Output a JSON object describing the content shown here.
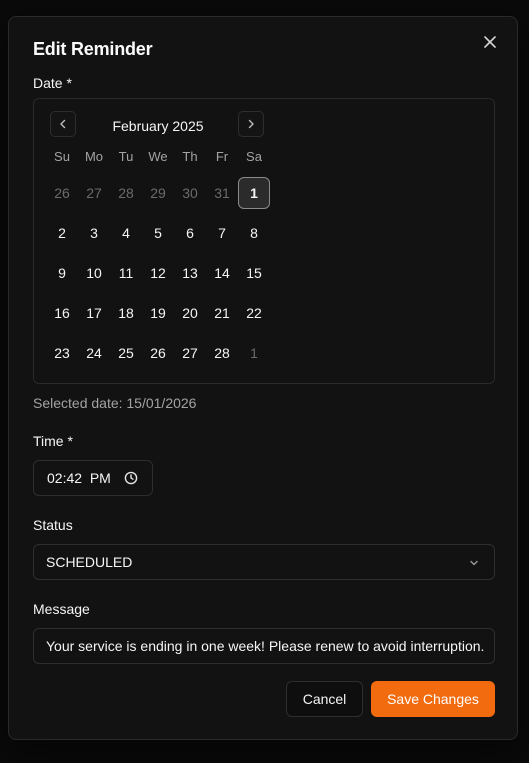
{
  "dialog": {
    "title": "Edit Reminder"
  },
  "date_field": {
    "label": "Date *",
    "calendar": {
      "month_label": "February 2025",
      "weekdays": [
        "Su",
        "Mo",
        "Tu",
        "We",
        "Th",
        "Fr",
        "Sa"
      ],
      "weeks": [
        [
          "26",
          "27",
          "28",
          "29",
          "30",
          "31",
          "1"
        ],
        [
          "2",
          "3",
          "4",
          "5",
          "6",
          "7",
          "8"
        ],
        [
          "9",
          "10",
          "11",
          "12",
          "13",
          "14",
          "15"
        ],
        [
          "16",
          "17",
          "18",
          "19",
          "20",
          "21",
          "22"
        ],
        [
          "23",
          "24",
          "25",
          "26",
          "27",
          "28",
          "1"
        ]
      ],
      "outside_month": [
        [
          true,
          true,
          true,
          true,
          true,
          true,
          false
        ],
        [
          false,
          false,
          false,
          false,
          false,
          false,
          false
        ],
        [
          false,
          false,
          false,
          false,
          false,
          false,
          false
        ],
        [
          false,
          false,
          false,
          false,
          false,
          false,
          false
        ],
        [
          false,
          false,
          false,
          false,
          false,
          false,
          true
        ]
      ],
      "highlighted_day": "1"
    },
    "helper_text": "Selected date: 15/01/2026"
  },
  "time_field": {
    "label": "Time *",
    "value": "02:42  PM"
  },
  "status_field": {
    "label": "Status",
    "value": "SCHEDULED"
  },
  "message_field": {
    "label": "Message",
    "value": "Your service is ending in one week! Please renew to avoid interruption."
  },
  "actions": {
    "cancel_label": "Cancel",
    "save_label": "Save Changes"
  },
  "colors": {
    "accent": "#f26b0f",
    "surface": "#121212",
    "border": "#2e2e2e"
  },
  "icons": [
    "close-icon",
    "chevron-left-icon",
    "chevron-right-icon",
    "clock-icon",
    "chevron-down-icon"
  ]
}
